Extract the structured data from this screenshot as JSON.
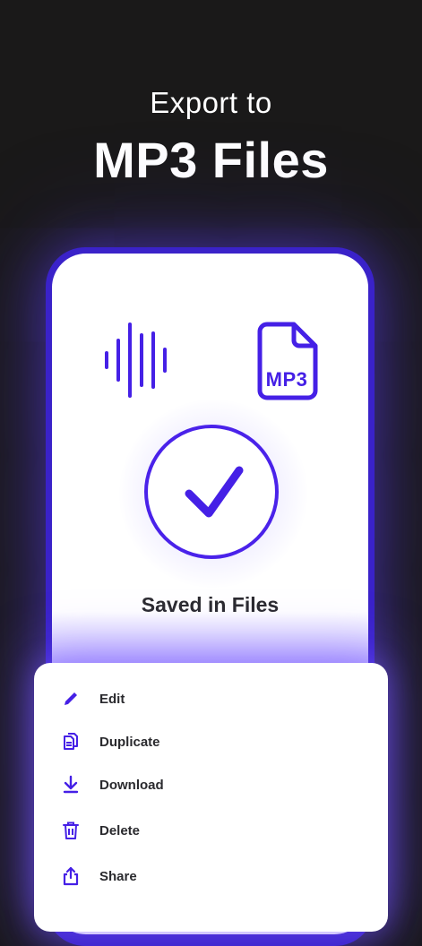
{
  "header": {
    "line1": "Export to",
    "line2": "MP3 Files"
  },
  "screen": {
    "file_badge": "MP3",
    "status_text": "Saved in Files"
  },
  "menu": {
    "items": [
      {
        "label": "Edit",
        "icon": "pencil-icon"
      },
      {
        "label": "Duplicate",
        "icon": "duplicate-icon"
      },
      {
        "label": "Download",
        "icon": "download-icon"
      },
      {
        "label": "Delete",
        "icon": "trash-icon"
      },
      {
        "label": "Share",
        "icon": "share-icon"
      }
    ]
  },
  "colors": {
    "background": "#1a1919",
    "accent": "#4520e6",
    "frame": "#3a22c9",
    "text_dark": "#2a2a2e",
    "white": "#ffffff"
  }
}
